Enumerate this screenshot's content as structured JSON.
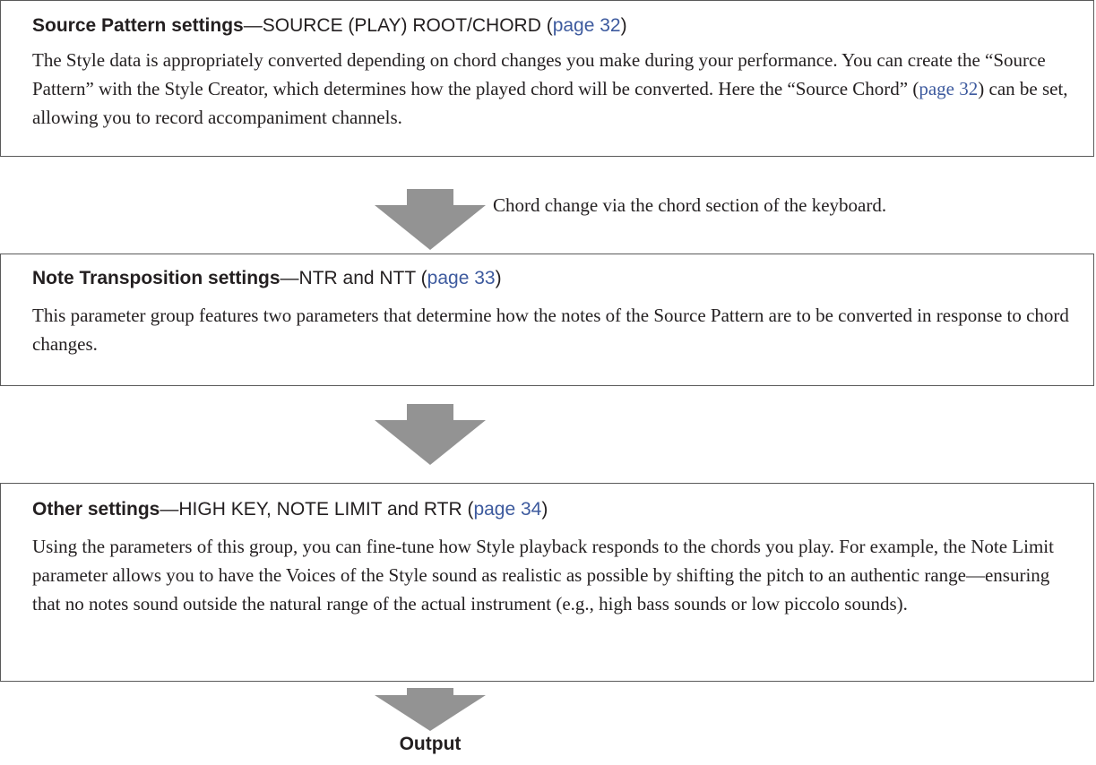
{
  "colors": {
    "text": "#231f20",
    "link": "#3d5a9e",
    "arrow": "#939393",
    "border": "#5a5a5a"
  },
  "source_box": {
    "title_bold": "Source Pattern settings",
    "title_rest": "—SOURCE (PLAY) ROOT/CHORD (",
    "title_link": "page 32",
    "title_close": ")",
    "body_part1": "The Style data is appropriately converted depending on chord changes you make during your performance. You can create the “Source Pattern” with the Style Creator, which determines how the played chord will be converted. Here the “Source Chord” (",
    "body_link": "page 32",
    "body_part2": ") can be set, allowing you to record accompaniment channels."
  },
  "arrow_note": "Chord change via the chord section of the keyboard.",
  "transpose_box": {
    "title_bold": "Note Transposition settings",
    "title_rest": "—NTR and NTT (",
    "title_link": "page 33",
    "title_close": ")",
    "body": "This parameter group features two parameters that determine how the notes of the Source Pattern are to be converted in response to chord changes."
  },
  "other_box": {
    "title_bold": "Other settings",
    "title_rest": "—HIGH KEY, NOTE LIMIT and RTR (",
    "title_link": "page 34",
    "title_close": ")",
    "body": "Using the parameters of this group, you can fine-tune how Style playback responds to the chords you play. For example, the Note Limit parameter allows you to have the Voices of the Style sound as realistic as possible by shifting the pitch to an authentic range—ensuring that no notes sound outside the natural range of the actual instrument (e.g., high bass sounds or low piccolo sounds)."
  },
  "output_label": "Output",
  "icons": {
    "flow_arrow": "down-arrow-icon"
  }
}
